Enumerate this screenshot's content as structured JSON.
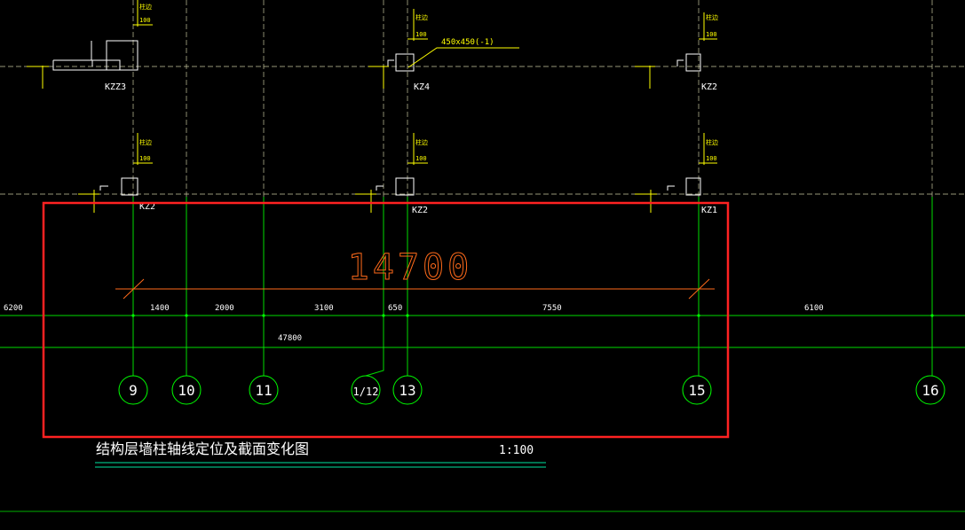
{
  "colors": {
    "background": "#000000",
    "axis_line": "#00ff00",
    "guide_line": "#c8c8a0",
    "cad_white": "#ffffff",
    "cad_yellow": "#ffff00",
    "dimension_orange": "#ff6a1a",
    "highlight_red": "#ff2222",
    "title_underline": "#00e5a0"
  },
  "columns": [
    {
      "tag": "KZZ3",
      "dim": "100",
      "note": "柱边"
    },
    {
      "tag": "KZ4",
      "dim": "100",
      "note": "柱边"
    },
    {
      "tag": "KZ2",
      "dim": "100",
      "note": "柱边"
    },
    {
      "tag": "KZ2",
      "dim": "100",
      "note": "柱边"
    },
    {
      "tag": "KZ2",
      "dim": "100",
      "note": "柱边"
    },
    {
      "tag": "KZ1",
      "dim": "100",
      "note": "柱边"
    }
  ],
  "section_callout": "450x450(-1)",
  "highlight_dimension": "14700",
  "axis_spacings": [
    "6200",
    "1400",
    "2000",
    "3100",
    "650",
    "7550",
    "6100"
  ],
  "total_dimension": "47800",
  "axes": [
    "9",
    "10",
    "11",
    "1/12",
    "13",
    "15",
    "16"
  ],
  "title": "结构层墙柱轴线定位及截面变化图",
  "scale": "1:100"
}
